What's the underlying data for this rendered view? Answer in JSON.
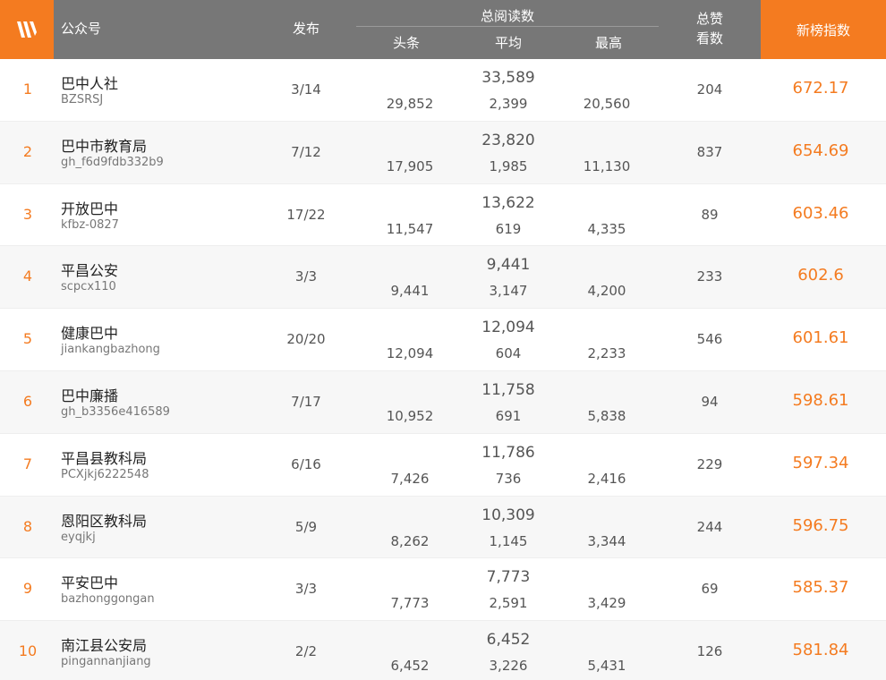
{
  "header": {
    "name": "公众号",
    "posts": "发布",
    "reads": "总阅读数",
    "head": "头条",
    "avg": "平均",
    "max": "最高",
    "likes_line1": "总赞",
    "likes_line2": "看数",
    "index": "新榜指数"
  },
  "colors": {
    "accent": "#f47b20",
    "header_bg": "#777777"
  },
  "rows": [
    {
      "rank": "1",
      "name": "巴中人社",
      "id": "BZSRSJ",
      "posts": "3/14",
      "total": "33,589",
      "head": "29,852",
      "avg": "2,399",
      "max": "20,560",
      "likes": "204",
      "score": "672.17"
    },
    {
      "rank": "2",
      "name": "巴中市教育局",
      "id": "gh_f6d9fdb332b9",
      "posts": "7/12",
      "total": "23,820",
      "head": "17,905",
      "avg": "1,985",
      "max": "11,130",
      "likes": "837",
      "score": "654.69"
    },
    {
      "rank": "3",
      "name": "开放巴中",
      "id": "kfbz-0827",
      "posts": "17/22",
      "total": "13,622",
      "head": "11,547",
      "avg": "619",
      "max": "4,335",
      "likes": "89",
      "score": "603.46"
    },
    {
      "rank": "4",
      "name": "平昌公安",
      "id": "scpcx110",
      "posts": "3/3",
      "total": "9,441",
      "head": "9,441",
      "avg": "3,147",
      "max": "4,200",
      "likes": "233",
      "score": "602.6"
    },
    {
      "rank": "5",
      "name": "健康巴中",
      "id": "jiankangbazhong",
      "posts": "20/20",
      "total": "12,094",
      "head": "12,094",
      "avg": "604",
      "max": "2,233",
      "likes": "546",
      "score": "601.61"
    },
    {
      "rank": "6",
      "name": "巴中廉播",
      "id": "gh_b3356e416589",
      "posts": "7/17",
      "total": "11,758",
      "head": "10,952",
      "avg": "691",
      "max": "5,838",
      "likes": "94",
      "score": "598.61"
    },
    {
      "rank": "7",
      "name": "平昌县教科局",
      "id": "PCXjkj6222548",
      "posts": "6/16",
      "total": "11,786",
      "head": "7,426",
      "avg": "736",
      "max": "2,416",
      "likes": "229",
      "score": "597.34"
    },
    {
      "rank": "8",
      "name": "恩阳区教科局",
      "id": "eyqjkj",
      "posts": "5/9",
      "total": "10,309",
      "head": "8,262",
      "avg": "1,145",
      "max": "3,344",
      "likes": "244",
      "score": "596.75"
    },
    {
      "rank": "9",
      "name": "平安巴中",
      "id": "bazhonggongan",
      "posts": "3/3",
      "total": "7,773",
      "head": "7,773",
      "avg": "2,591",
      "max": "3,429",
      "likes": "69",
      "score": "585.37"
    },
    {
      "rank": "10",
      "name": "南江县公安局",
      "id": "pingannanjiang",
      "posts": "2/2",
      "total": "6,452",
      "head": "6,452",
      "avg": "3,226",
      "max": "5,431",
      "likes": "126",
      "score": "581.84"
    }
  ]
}
